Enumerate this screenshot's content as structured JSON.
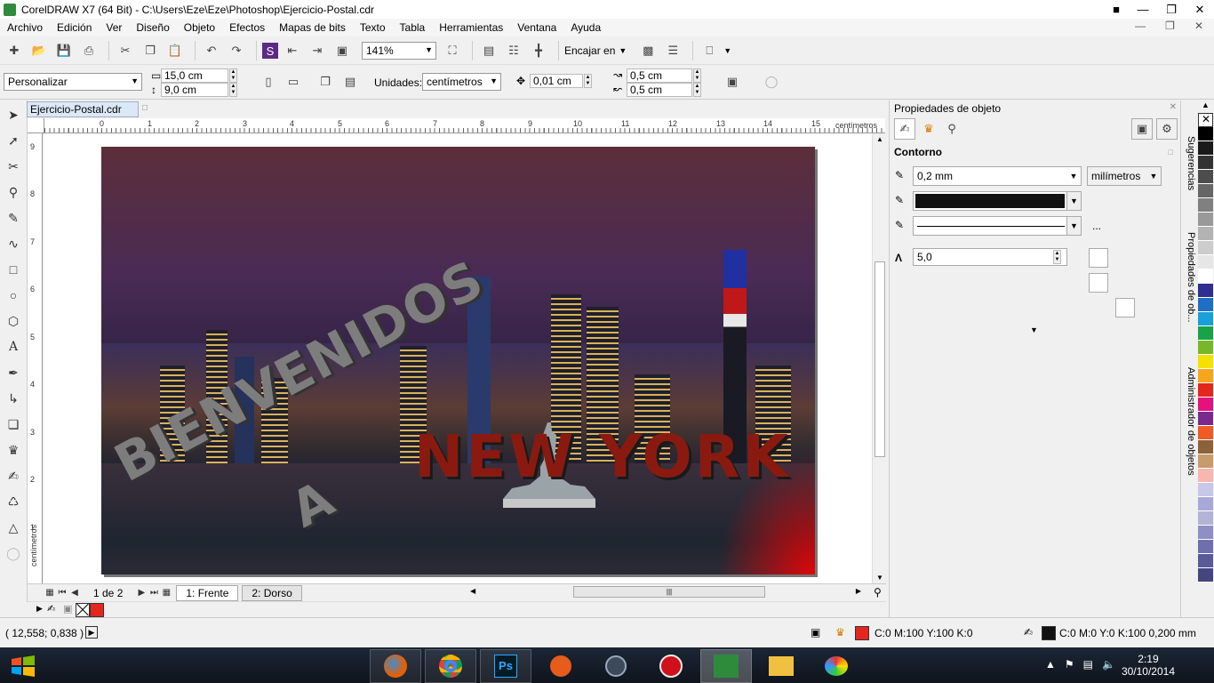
{
  "window": {
    "title": "CorelDRAW X7 (64 Bit) - C:\\Users\\Eze\\Eze\\Photoshop\\Ejercicio-Postal.cdr"
  },
  "menu": [
    "Archivo",
    "Edición",
    "Ver",
    "Diseño",
    "Objeto",
    "Efectos",
    "Mapas de bits",
    "Texto",
    "Tabla",
    "Herramientas",
    "Ventana",
    "Ayuda"
  ],
  "toolbar": {
    "zoom": "141%",
    "fit_label": "Encajar en"
  },
  "propbar": {
    "preset": "Personalizar",
    "width": "15,0 cm",
    "height": "9,0 cm",
    "units_label": "Unidades:",
    "units_value": "centímetros",
    "nudge": "0,01 cm",
    "dup_x": "0,5 cm",
    "dup_y": "0,5 cm"
  },
  "document": {
    "tab": "Ejercicio-Postal.cdr",
    "ruler_unit": "centímetros"
  },
  "ruler_h_ticks": [
    "0",
    "1",
    "2",
    "3",
    "4",
    "5",
    "6",
    "7",
    "8",
    "9",
    "10",
    "11",
    "12",
    "13",
    "14",
    "15"
  ],
  "ruler_v_ticks": [
    "9",
    "8",
    "7",
    "6",
    "5",
    "4",
    "3",
    "2",
    "1"
  ],
  "artwork": {
    "line1": "BIENVENIDOS",
    "line2": "A",
    "line3": "NEW YORK"
  },
  "pages": {
    "count_label": "1 de 2",
    "tab1": "1: Frente",
    "tab2": "2: Dorso"
  },
  "docker": {
    "title": "Propiedades de objeto",
    "section": "Contorno",
    "width_value": "0,2 mm",
    "width_units": "milímetros",
    "more": "...",
    "miter": "5,0"
  },
  "docker_tabs": [
    "Sugerencias",
    "Propiedades de ob...",
    "Administrador de objetos"
  ],
  "palette": [
    "#000000",
    "#1a1a1a",
    "#333333",
    "#4d4d4d",
    "#666666",
    "#808080",
    "#999999",
    "#b3b3b3",
    "#cccccc",
    "#e6e6e6",
    "#ffffff",
    "#2e2f8f",
    "#1f6fc4",
    "#1aa0d8",
    "#18a348",
    "#76b82a",
    "#f5e100",
    "#f7a51c",
    "#e4271d",
    "#e5127b",
    "#7a2a8c",
    "#f15a24",
    "#8c6239",
    "#c69c6d",
    "#f7b6b0",
    "#c7c7e8",
    "#a8a8d8",
    "#b3b3d6",
    "#8f8fc4",
    "#6f6fae",
    "#5a5a96",
    "#45457f"
  ],
  "status": {
    "coords": "( 12,558; 0,838 )",
    "fill": "C:0 M:100 Y:100 K:0",
    "outline": "C:0 M:0 Y:0 K:100  0,200 mm",
    "fill_color": "#e4271d",
    "outline_color": "#111111"
  },
  "taskbar": {
    "time": "2:19",
    "date": "30/10/2014"
  }
}
